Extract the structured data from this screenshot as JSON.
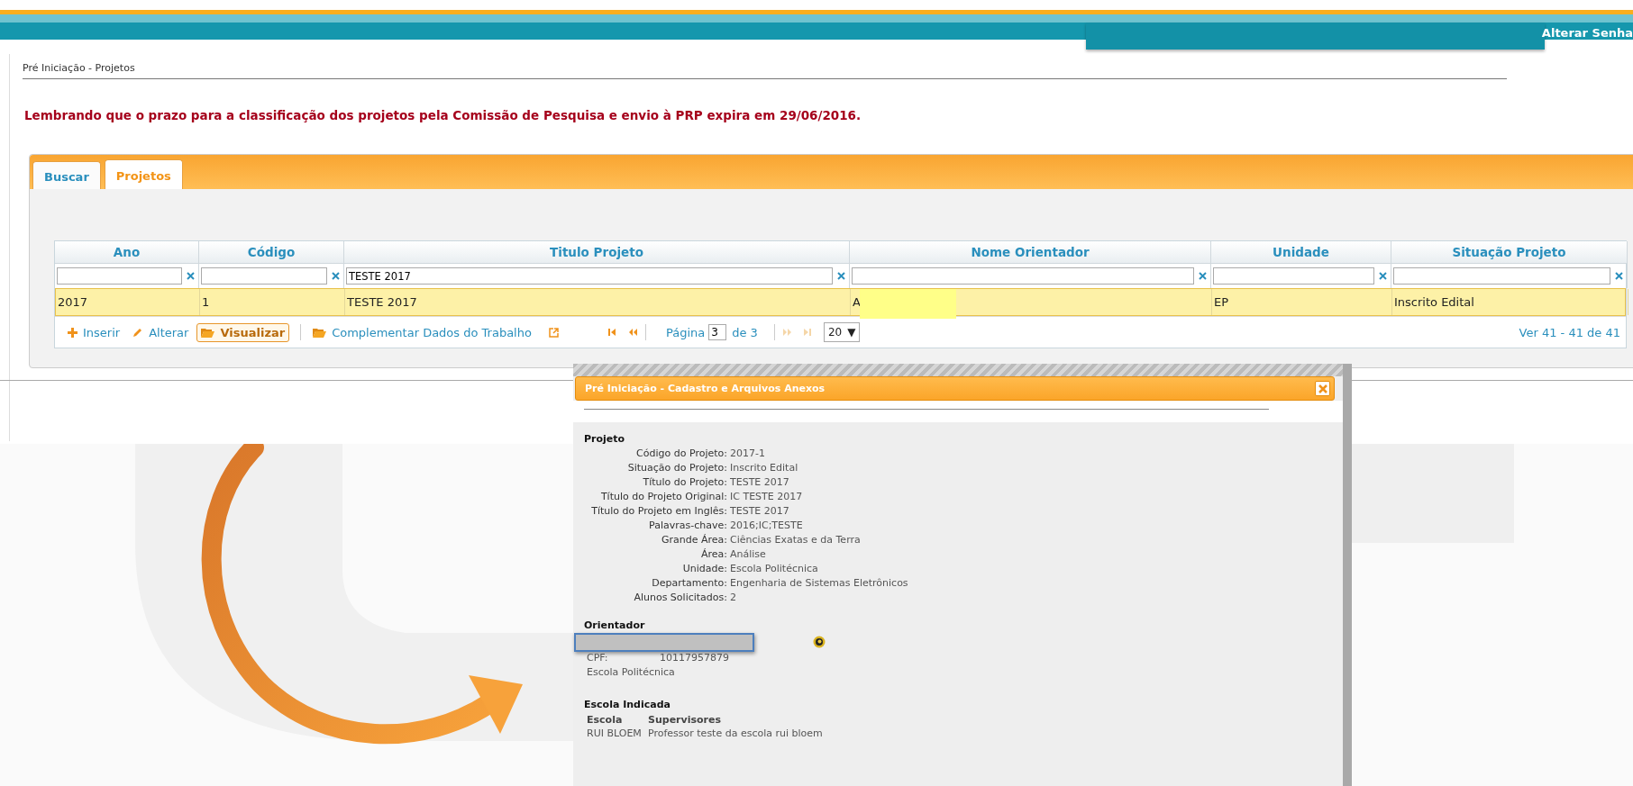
{
  "header": {
    "link": "Alterar Senha"
  },
  "breadcrumb": "Pré Iniciação - Projetos",
  "notice": "Lembrando que o prazo para a classificação dos projetos pela Comissão de Pesquisa e envio à PRP expira em 29/06/2016.",
  "tabs": [
    {
      "label": "Buscar",
      "selected": false
    },
    {
      "label": "Projetos",
      "selected": true
    }
  ],
  "grid": {
    "columns": [
      {
        "title": "Ano"
      },
      {
        "title": "Código"
      },
      {
        "title": "Titulo Projeto",
        "filter": "TESTE 2017"
      },
      {
        "title": "Nome Orientador"
      },
      {
        "title": "Unidade"
      },
      {
        "title": "Situação Projeto"
      }
    ],
    "rows": [
      {
        "cells": [
          "2017",
          "1",
          "TESTE 2017",
          "A",
          "EP",
          "Inscrito Edital"
        ],
        "selected": true
      }
    ]
  },
  "toolbar": {
    "actions": [
      {
        "label": "Inserir",
        "kind": "plus",
        "active": false
      },
      {
        "label": "Alterar",
        "kind": "pencil",
        "active": false
      },
      {
        "label": "Visualizar",
        "kind": "folder",
        "active": true
      },
      {
        "label": "Complementar Dados do Trabalho",
        "kind": "folder",
        "active": false
      }
    ],
    "nav": [
      {
        "kind": "first",
        "disabled": false
      },
      {
        "kind": "prev",
        "disabled": false
      },
      {
        "kind": "next",
        "disabled": true
      },
      {
        "kind": "last",
        "disabled": true
      }
    ],
    "page_label": "Página",
    "page": "3",
    "page_total": "de 3",
    "page_size": "20",
    "page_size_caret": "▼",
    "summary": "Ver 41 - 41 de 41"
  },
  "dialog": {
    "title": "Pré Iniciação - Cadastro e Arquivos Anexos",
    "project_heading": "Projeto",
    "fields": [
      {
        "label": "Código do Projeto:",
        "value": "2017-1"
      },
      {
        "label": "Situação do Projeto:",
        "value": "Inscrito Edital"
      },
      {
        "label": "Título do Projeto:",
        "value": "TESTE 2017"
      },
      {
        "label": "Título do Projeto Original:",
        "value": "IC TESTE 2017"
      },
      {
        "label": "Título do Projeto em Inglês:",
        "value": "TESTE 2017"
      },
      {
        "label": "Palavras-chave:",
        "value": "2016;IC;TESTE"
      },
      {
        "label": "Grande Área:",
        "value": "Ciências Exatas e da Terra"
      },
      {
        "label": "Área:",
        "value": "Análise"
      },
      {
        "label": "Unidade:",
        "value": "Escola Politécnica"
      },
      {
        "label": "Departamento:",
        "value": "Engenharia de Sistemas Eletrônicos"
      },
      {
        "label": "Alunos Solicitados:",
        "value": "2"
      }
    ],
    "advisor_heading": "Orientador",
    "cpf_label": "CPF:",
    "cpf": "10117957879",
    "advisor_unit": "Escola Politécnica",
    "school_heading": "Escola Indicada",
    "school_columns": [
      "Escola",
      "Supervisores"
    ],
    "school_rows": [
      [
        "RUI BLOEM",
        "Professor teste da escola rui bloem"
      ]
    ]
  }
}
